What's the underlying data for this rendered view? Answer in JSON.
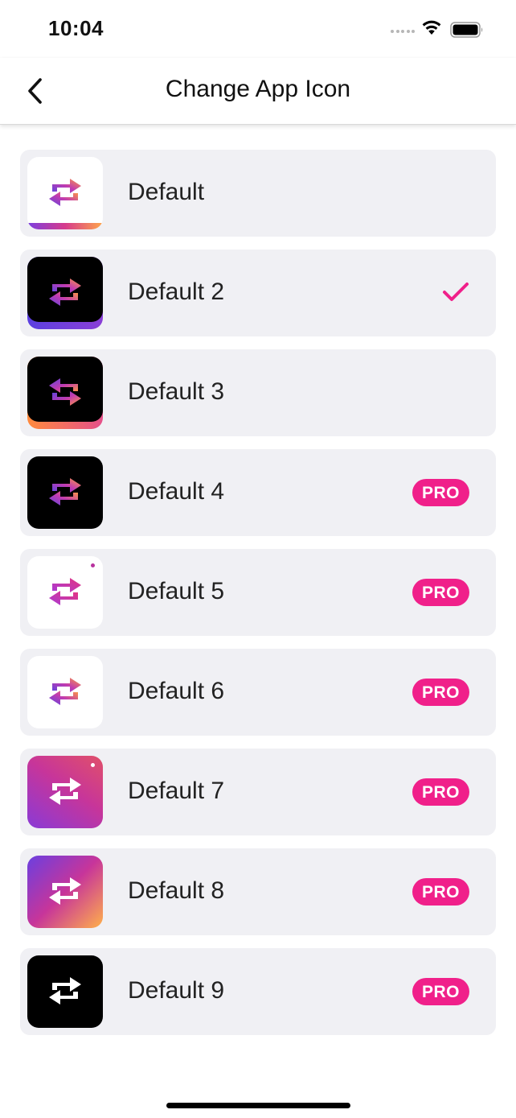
{
  "status_bar": {
    "time": "10:04"
  },
  "nav": {
    "title": "Change App Icon"
  },
  "accent_color": "#f0208a",
  "selected_item": "Default 2",
  "items": [
    {
      "label": "Default",
      "icon_style": "white-gradient-arrows-bottom-gradient-bar",
      "badge": ""
    },
    {
      "label": "Default 2",
      "icon_style": "black-gradient-arrows-bottom-purple-bar",
      "badge": ""
    },
    {
      "label": "Default 3",
      "icon_style": "black-gradient-arrows-bottom-orange-bar",
      "badge": ""
    },
    {
      "label": "Default 4",
      "icon_style": "black-gradient-arrows",
      "badge": "PRO"
    },
    {
      "label": "Default 5",
      "icon_style": "white-pink-arrows-dot",
      "badge": "PRO"
    },
    {
      "label": "Default 6",
      "icon_style": "white-gradient-arrows",
      "badge": "PRO"
    },
    {
      "label": "Default 7",
      "icon_style": "pink-gradient-white-arrows-dot",
      "badge": "PRO"
    },
    {
      "label": "Default 8",
      "icon_style": "purple-orange-gradient-white-arrows",
      "badge": "PRO"
    },
    {
      "label": "Default 9",
      "icon_style": "black-white-arrows",
      "badge": "PRO"
    }
  ]
}
